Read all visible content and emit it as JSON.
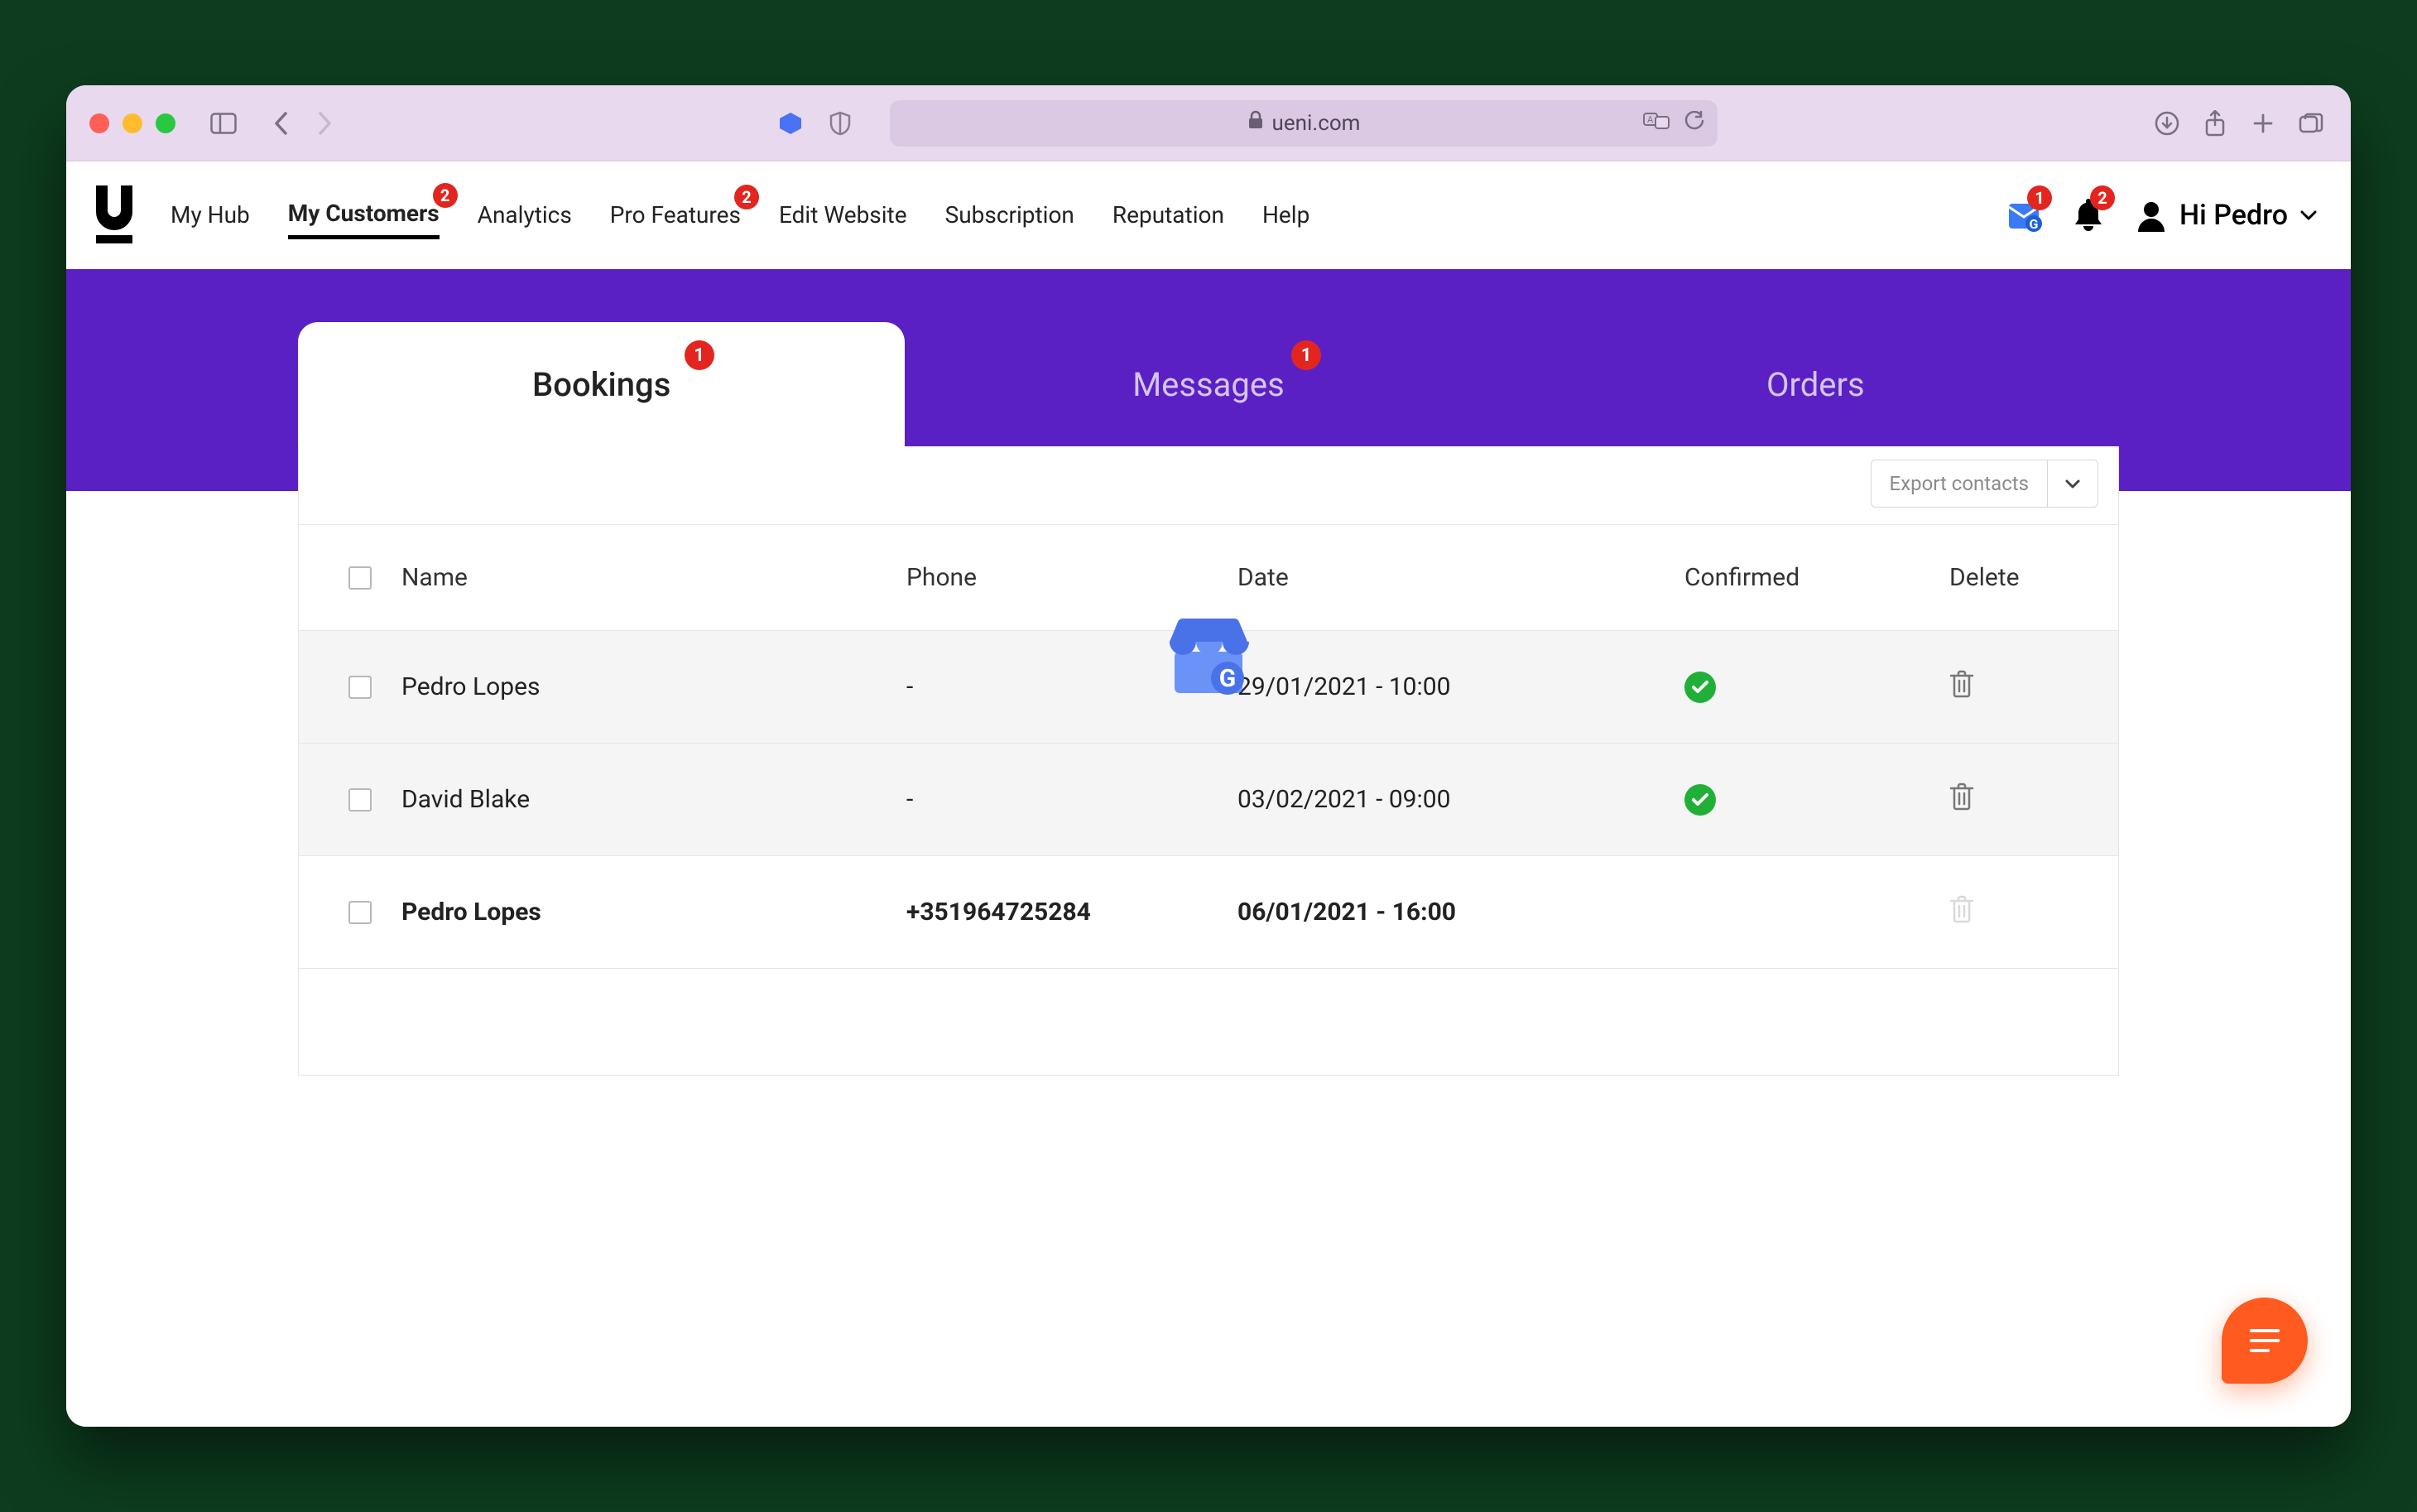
{
  "browser": {
    "url_host": "ueni.com"
  },
  "header": {
    "nav": [
      {
        "label": "My Hub",
        "active": false
      },
      {
        "label": "My Customers",
        "active": true,
        "badge": "2"
      },
      {
        "label": "Analytics",
        "active": false
      },
      {
        "label": "Pro Features",
        "active": false,
        "badge": "2"
      },
      {
        "label": "Edit Website",
        "active": false
      },
      {
        "label": "Subscription",
        "active": false
      },
      {
        "label": "Reputation",
        "active": false
      },
      {
        "label": "Help",
        "active": false
      }
    ],
    "google_badge": "1",
    "bell_badge": "2",
    "user_label": "Hi Pedro"
  },
  "tabs": {
    "bookings": {
      "label": "Bookings",
      "badge": "1"
    },
    "messages": {
      "label": "Messages",
      "badge": "1"
    },
    "orders": {
      "label": "Orders"
    }
  },
  "export_label": "Export contacts",
  "columns": {
    "name": "Name",
    "phone": "Phone",
    "date": "Date",
    "confirmed": "Confirmed",
    "delete": "Delete"
  },
  "rows": [
    {
      "name": "Pedro Lopes",
      "phone": "-",
      "date": "29/01/2021 - 10:00",
      "confirmed": true,
      "bold": false
    },
    {
      "name": "David Blake",
      "phone": "-",
      "date": "03/02/2021 - 09:00",
      "confirmed": true,
      "bold": false
    },
    {
      "name": "Pedro Lopes",
      "phone": "+351964725284",
      "date": "06/01/2021 - 16:00",
      "confirmed": false,
      "bold": true
    }
  ]
}
